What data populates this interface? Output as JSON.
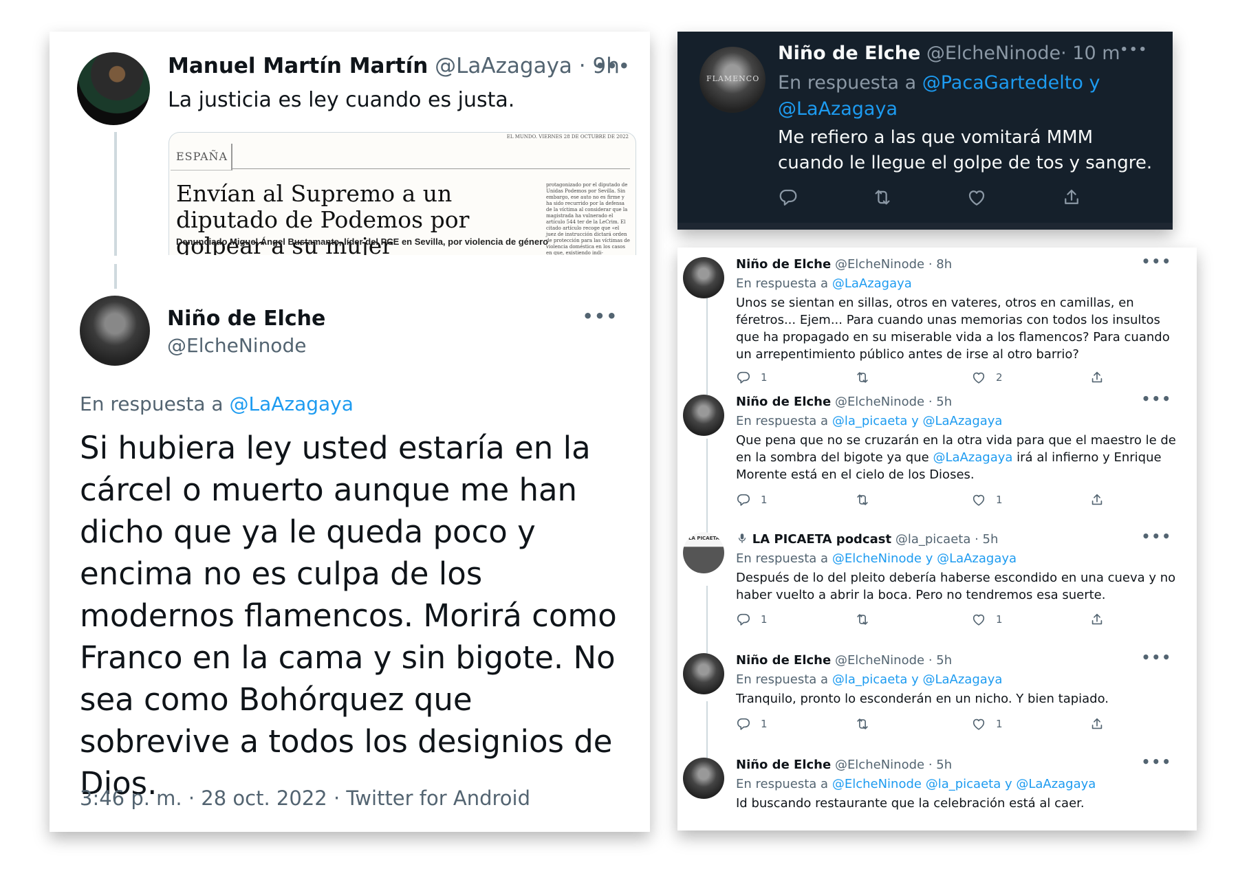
{
  "left_card": {
    "tweet1": {
      "name": "Manuel Martín Martín",
      "handle": "@LaAzagaya",
      "time": "· 9h",
      "text": "La justicia es ley cuando es justa.",
      "more": "•••",
      "newspaper": {
        "section": "ESPAÑA",
        "topline": "EL MUNDO. VIERNES 28 DE OCTUBRE DE 2022",
        "headline": "Envían al Supremo a un diputado de Podemos por golpear a su mujer",
        "subhead": "Denunciado Miguel Ángel Bustamante, líder del PCE en Sevilla, por violencia de género",
        "column_text": "protagonizado por el diputado de Unidas Podemos por Sevilla. Sin embargo, ese auto no es firme y ha sido recurrido por la defensa de la víctima al considerar que la magistrada ha vulnerado el artículo 544 ter de la LeCrim. El citado artículo recoge que «el juez de instrucción dictará orden de protección para las víctimas de violencia doméstica en los casos en que, existiendo indi-"
      }
    },
    "tweet2": {
      "name": "Niño de Elche",
      "handle": "@ElcheNinode",
      "more": "•••",
      "reply_prefix": "En respuesta a",
      "reply_to": "@LaAzagaya",
      "text": "Si hubiera ley usted estaría en la cárcel o muerto aunque me han dicho que ya le queda poco y encima no es culpa de los modernos flamencos. Morirá como Franco en la cama y sin bigote. No sea como Bohórquez que sobrevive a todos los designios de Dios.",
      "timestamp": "3:46 p. m. · 28 oct. 2022 · Twitter for Android"
    }
  },
  "dark_card": {
    "name": "Niño de Elche",
    "handle": "@ElcheNinode",
    "time": "· 10 m",
    "more": "•••",
    "reply_prefix": "En respuesta a",
    "reply_to_1": "@PacaGartedelto y",
    "reply_to_2": "@LaAzagaya",
    "text": "Me refiero a las que vomitará MMM cuando le llegue el golpe de tos y sangre.",
    "avatar_label": "FLAMENCO"
  },
  "right_card": {
    "tweets": [
      {
        "name": "Niño de Elche",
        "handle": "@ElcheNinode",
        "time": "· 8h",
        "reply_prefix": "En respuesta a",
        "reply_to": "@LaAzagaya",
        "text": "Unos se sientan en sillas, otros en vateres, otros en camillas, en féretros... Ejem... Para cuando unas memorias con todos los insultos que ha propagado en su miserable vida a los flamencos? Para cuando un arrepentimiento público antes de irse al otro barrio?",
        "replies": "1",
        "retweets": "",
        "likes": "2"
      },
      {
        "name": "Niño de Elche",
        "handle": "@ElcheNinode",
        "time": "· 5h",
        "reply_prefix": "En respuesta a",
        "reply_to": "@la_picaeta y @LaAzagaya",
        "text_a": "Que pena que no se cruzarán en la otra vida para que el maestro le de en la sombra del bigote ya que ",
        "text_mention": "@LaAzagaya",
        "text_b": " irá al infierno y Enrique Morente está en el cielo de los Dioses.",
        "replies": "1",
        "retweets": "",
        "likes": "1"
      },
      {
        "name": "LA PICAETA podcast",
        "handle": "@la_picaeta",
        "time": "· 5h",
        "reply_prefix": "En respuesta a",
        "reply_to": "@ElcheNinode y @LaAzagaya",
        "text": "Después de lo del pleito debería haberse escondido en una cueva y no haber vuelto a abrir la boca. Pero no tendremos esa suerte.",
        "replies": "1",
        "retweets": "",
        "likes": "1",
        "avatar_label": "LA PICAETA"
      },
      {
        "name": "Niño de Elche",
        "handle": "@ElcheNinode",
        "time": "· 5h",
        "reply_prefix": "En respuesta a",
        "reply_to": "@la_picaeta y @LaAzagaya",
        "text": "Tranquilo, pronto lo esconderán en un nicho. Y bien tapiado.",
        "replies": "1",
        "retweets": "",
        "likes": "1"
      },
      {
        "name": "Niño de Elche",
        "handle": "@ElcheNinode",
        "time": "· 5h",
        "reply_prefix": "En respuesta a",
        "reply_to": "@ElcheNinode @la_picaeta y @LaAzagaya",
        "text": "Id buscando restaurante que la celebración está al caer."
      }
    ],
    "more": "•••"
  },
  "colors": {
    "link": "#1d9bf0",
    "muted": "#536471",
    "dark_bg": "#15202b"
  }
}
